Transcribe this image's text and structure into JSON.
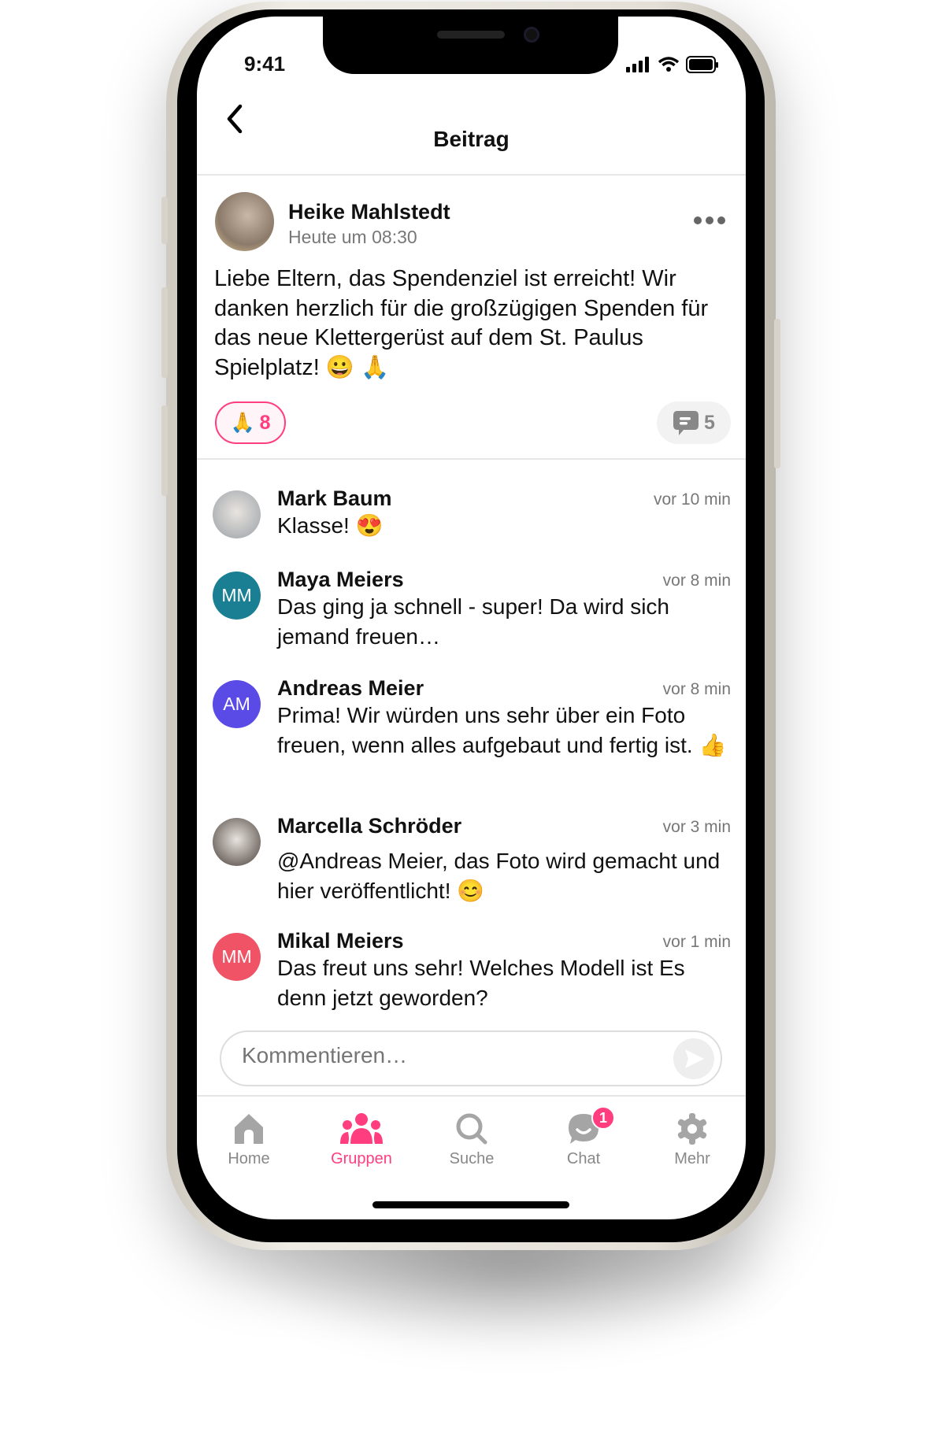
{
  "status_bar": {
    "time": "9:41"
  },
  "header": {
    "title": "Beitrag"
  },
  "post": {
    "author": "Heike Mahlstedt",
    "time": "Heute um 08:30",
    "text": "Liebe Eltern, das Spendenziel ist erreicht! Wir danken herzlich für die großzügigen Spenden für das neue Klettergerüst auf dem St. Paulus Spielplatz! 😀 🙏",
    "reaction_emoji": "🙏",
    "reaction_count": "8",
    "comment_count": "5"
  },
  "comments": [
    {
      "name": "Mark Baum",
      "time": "vor 10 min",
      "text": "Klasse! 😍",
      "initials": "",
      "color": "#9aa0a6"
    },
    {
      "name": "Maya Meiers",
      "time": "vor 8 min",
      "text": "Das ging ja schnell - super! Da wird sich jemand freuen…",
      "initials": "MM",
      "color": "#1a7f93"
    },
    {
      "name": "Andreas Meier",
      "time": "vor 8 min",
      "text": "Prima! Wir würden uns sehr über ein Foto freuen, wenn alles aufgebaut und fertig ist. 👍",
      "initials": "AM",
      "color": "#5a4ae6"
    },
    {
      "name": "Marcella Schröder",
      "time": "vor 3 min",
      "text": "@Andreas Meier, das Foto wird gemacht und hier veröffentlicht! 😊",
      "initials": "",
      "color": "#4a3f3a"
    },
    {
      "name": "Mikal Meiers",
      "time": "vor 1 min",
      "text": "Das freut uns sehr! Welches Modell ist Es denn jetzt geworden?",
      "initials": "MM",
      "color": "#ef5365"
    }
  ],
  "comment_input": {
    "placeholder": "Kommentieren…"
  },
  "nav": [
    {
      "label": "Home",
      "icon": "home-icon"
    },
    {
      "label": "Gruppen",
      "icon": "groups-icon",
      "active": true
    },
    {
      "label": "Suche",
      "icon": "search-icon"
    },
    {
      "label": "Chat",
      "icon": "chat-icon",
      "badge": "1"
    },
    {
      "label": "Mehr",
      "icon": "gear-icon"
    }
  ],
  "colors": {
    "accent": "#ff3d7f",
    "inactive": "#a5a5a5"
  }
}
